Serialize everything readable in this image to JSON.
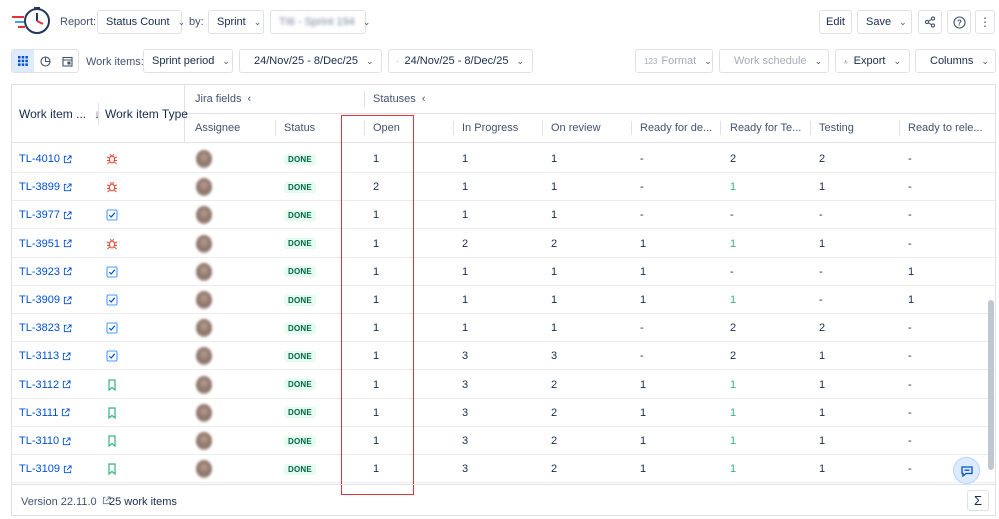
{
  "header": {
    "report_label": "Report:",
    "report_value": "Status Count",
    "by_label": "by:",
    "by_value": "Sprint",
    "sprint_value": "TI6 - Sprint 194",
    "edit_label": "Edit",
    "save_label": "Save"
  },
  "toolbar": {
    "work_items_label": "Work items:",
    "work_items_value": "Sprint period",
    "date_range_1": "24/Nov/25 - 8/Dec/25",
    "date_range_2": "24/Nov/25 - 8/Dec/25",
    "format_label": "Format",
    "format_prefix": "123",
    "work_schedule_label": "Work schedule",
    "export_label": "Export",
    "columns_label": "Columns"
  },
  "grid": {
    "group_headers": {
      "jira_fields": "Jira fields",
      "statuses": "Statuses"
    },
    "columns": {
      "work_item": "Work item ...",
      "work_item_type": "Work item Type",
      "assignee": "Assignee",
      "status": "Status",
      "open": "Open",
      "in_progress": "In Progress",
      "on_review": "On review",
      "ready_for_dev": "Ready for de...",
      "ready_for_test": "Ready for Te...",
      "testing": "Testing",
      "ready_to_release": "Ready to rele..."
    },
    "rows": [
      {
        "key": "TL-4010",
        "type": "bug",
        "status": "DONE",
        "open": "1",
        "in_progress": "1",
        "on_review": "1",
        "ready_for_dev": "-",
        "ready_for_test": "2",
        "testing": "2",
        "ready_to_release": "-"
      },
      {
        "key": "TL-3899",
        "type": "bug",
        "status": "DONE",
        "open": "2",
        "in_progress": "1",
        "on_review": "1",
        "ready_for_dev": "-",
        "ready_for_test": "1",
        "testing": "1",
        "ready_to_release": "-"
      },
      {
        "key": "TL-3977",
        "type": "task",
        "status": "DONE",
        "open": "1",
        "in_progress": "1",
        "on_review": "1",
        "ready_for_dev": "-",
        "ready_for_test": "-",
        "testing": "-",
        "ready_to_release": "-"
      },
      {
        "key": "TL-3951",
        "type": "bug",
        "status": "DONE",
        "open": "1",
        "in_progress": "2",
        "on_review": "2",
        "ready_for_dev": "1",
        "ready_for_test": "1",
        "testing": "1",
        "ready_to_release": "-"
      },
      {
        "key": "TL-3923",
        "type": "task",
        "status": "DONE",
        "open": "1",
        "in_progress": "1",
        "on_review": "1",
        "ready_for_dev": "1",
        "ready_for_test": "-",
        "testing": "-",
        "ready_to_release": "1"
      },
      {
        "key": "TL-3909",
        "type": "task",
        "status": "DONE",
        "open": "1",
        "in_progress": "1",
        "on_review": "1",
        "ready_for_dev": "1",
        "ready_for_test": "1",
        "testing": "-",
        "ready_to_release": "1"
      },
      {
        "key": "TL-3823",
        "type": "task",
        "status": "DONE",
        "open": "1",
        "in_progress": "1",
        "on_review": "1",
        "ready_for_dev": "-",
        "ready_for_test": "2",
        "testing": "2",
        "ready_to_release": "-"
      },
      {
        "key": "TL-3113",
        "type": "task",
        "status": "DONE",
        "open": "1",
        "in_progress": "3",
        "on_review": "3",
        "ready_for_dev": "-",
        "ready_for_test": "2",
        "testing": "1",
        "ready_to_release": "-"
      },
      {
        "key": "TL-3112",
        "type": "story",
        "status": "DONE",
        "open": "1",
        "in_progress": "3",
        "on_review": "2",
        "ready_for_dev": "1",
        "ready_for_test": "1",
        "testing": "1",
        "ready_to_release": "-"
      },
      {
        "key": "TL-3111",
        "type": "story",
        "status": "DONE",
        "open": "1",
        "in_progress": "3",
        "on_review": "2",
        "ready_for_dev": "1",
        "ready_for_test": "1",
        "testing": "1",
        "ready_to_release": "-"
      },
      {
        "key": "TL-3110",
        "type": "story",
        "status": "DONE",
        "open": "1",
        "in_progress": "3",
        "on_review": "2",
        "ready_for_dev": "1",
        "ready_for_test": "1",
        "testing": "1",
        "ready_to_release": "-"
      },
      {
        "key": "TL-3109",
        "type": "story",
        "status": "DONE",
        "open": "1",
        "in_progress": "3",
        "on_review": "2",
        "ready_for_dev": "1",
        "ready_for_test": "1",
        "testing": "1",
        "ready_to_release": "-"
      }
    ]
  },
  "footer": {
    "version": "Version 22.11.0",
    "count": "25 work items",
    "sum_symbol": "Σ"
  },
  "colors": {
    "link": "#0052cc",
    "done_bg": "#e3fcef",
    "done_text": "#006644",
    "highlight": "#e5313a",
    "green_value": "#36b37e",
    "bug_icon": "#e5493a",
    "task_icon": "#4c9aff",
    "story_icon": "#36b37e"
  }
}
